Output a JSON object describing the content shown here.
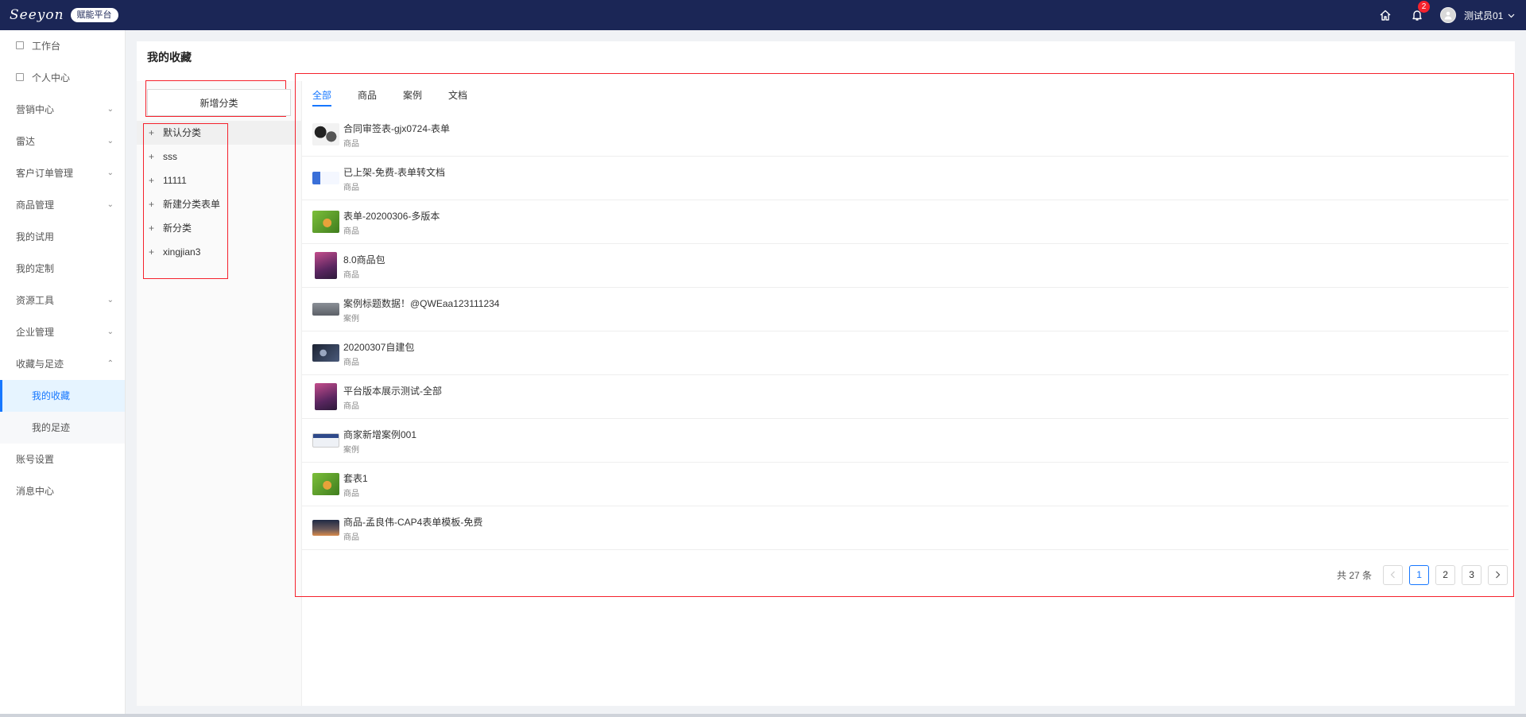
{
  "header": {
    "logo_text": "Seeyon",
    "platform_badge": "赋能平台",
    "notification_count": "2",
    "user_name": "测试员01",
    "icons": [
      "home-icon",
      "bell-icon",
      "avatar",
      "chevron-down-icon"
    ]
  },
  "sidebar": {
    "items": [
      {
        "label": "工作台",
        "icon": "doc-icon"
      },
      {
        "label": "个人中心",
        "icon": "doc-icon"
      },
      {
        "label": "营销中心",
        "expandable": true
      },
      {
        "label": "雷达",
        "expandable": true
      },
      {
        "label": "客户订单管理",
        "expandable": true
      },
      {
        "label": "商品管理",
        "expandable": true
      },
      {
        "label": "我的试用"
      },
      {
        "label": "我的定制"
      },
      {
        "label": "资源工具",
        "expandable": true
      },
      {
        "label": "企业管理",
        "expandable": true
      },
      {
        "label": "收藏与足迹",
        "expanded": true
      },
      {
        "label": "我的收藏",
        "active": true
      },
      {
        "label": "我的足迹"
      },
      {
        "label": "账号设置"
      },
      {
        "label": "消息中心"
      }
    ]
  },
  "page": {
    "title": "我的收藏",
    "add_category_label": "新增分类",
    "categories": [
      "默认分类",
      "sss",
      "11111",
      "新建分类表单",
      "新分类",
      "xingjian3"
    ],
    "tabs": [
      {
        "label": "全部",
        "active": true
      },
      {
        "label": "商品"
      },
      {
        "label": "案例"
      },
      {
        "label": "文档"
      }
    ],
    "favorites": [
      {
        "title": "合同审签表-gjx0724-表单",
        "type": "商品",
        "thumb": "cartoon-thumb"
      },
      {
        "title": "已上架-免费-表单转文档",
        "type": "商品",
        "thumb": "logo-thumb"
      },
      {
        "title": "表单-20200306-多版本",
        "type": "商品",
        "thumb": "green-thumb"
      },
      {
        "title": "8.0商品包",
        "type": "商品",
        "thumb": "purple-thumb"
      },
      {
        "title": "案例标题数据！@QWEaa123111234",
        "type": "案例",
        "thumb": "gray-thumb"
      },
      {
        "title": "20200307自建包",
        "type": "商品",
        "thumb": "dark-thumb"
      },
      {
        "title": "平台版本展示测试-全部",
        "type": "商品",
        "thumb": "purple-thumb"
      },
      {
        "title": "商家新增案例001",
        "type": "案例",
        "thumb": "screen-thumb"
      },
      {
        "title": "套表1",
        "type": "商品",
        "thumb": "green-thumb"
      },
      {
        "title": "商品-孟良伟-CAP4表单模板-免费",
        "type": "商品",
        "thumb": "sunset-thumb"
      }
    ],
    "pagination": {
      "total_text": "共 27 条",
      "pages": [
        "1",
        "2",
        "3"
      ],
      "current": "1"
    }
  },
  "colors": {
    "header_bg": "#1b2656",
    "accent": "#1677ff",
    "highlight_box": "#f5222d"
  }
}
